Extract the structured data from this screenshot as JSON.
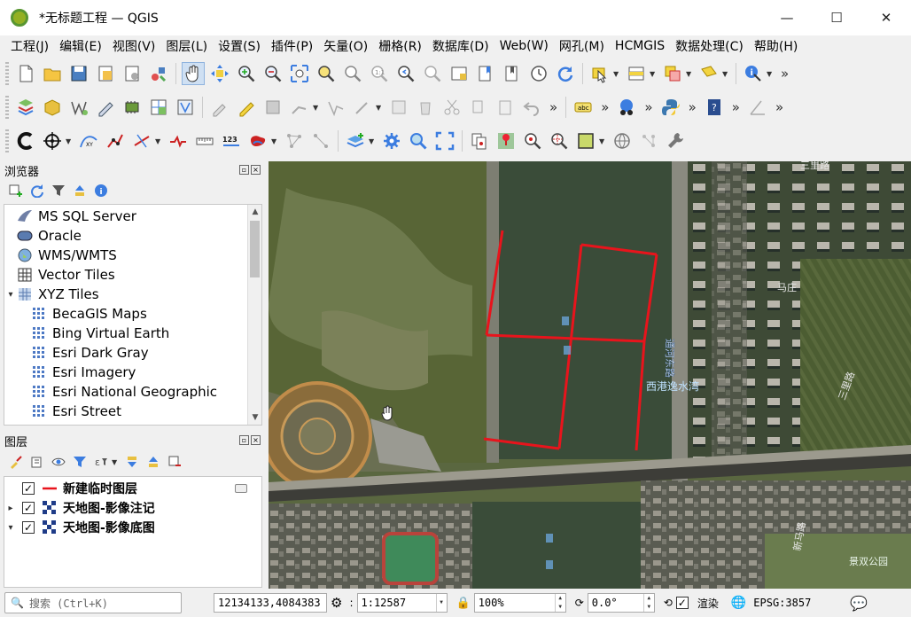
{
  "window": {
    "title": "*无标题工程 — QGIS",
    "minimize": "—",
    "maximize": "☐",
    "close": "✕"
  },
  "menu": [
    "工程(J)",
    "编辑(E)",
    "视图(V)",
    "图层(L)",
    "设置(S)",
    "插件(P)",
    "矢量(O)",
    "栅格(R)",
    "数据库(D)",
    "Web(W)",
    "网孔(M)",
    "HCMGIS",
    "数据处理(C)",
    "帮助(H)"
  ],
  "toolbar": {
    "more": "»",
    "measure_label": "123"
  },
  "browser": {
    "title": "浏览器",
    "items": [
      {
        "label": "MS SQL Server",
        "icon": "mssql-icon",
        "level": 0
      },
      {
        "label": "Oracle",
        "icon": "oracle-icon",
        "level": 0
      },
      {
        "label": "WMS/WMTS",
        "icon": "wms-globe-icon",
        "level": 0
      },
      {
        "label": "Vector Tiles",
        "icon": "vector-tiles-icon",
        "level": 0
      },
      {
        "label": "XYZ Tiles",
        "icon": "xyz-tiles-icon",
        "level": 0,
        "expanded": true
      },
      {
        "label": "BecaGIS Maps",
        "icon": "xyz-grid-icon",
        "level": 1
      },
      {
        "label": "Bing Virtual Earth",
        "icon": "xyz-grid-icon",
        "level": 1
      },
      {
        "label": "Esri Dark Gray",
        "icon": "xyz-grid-icon",
        "level": 1
      },
      {
        "label": "Esri Imagery",
        "icon": "xyz-grid-icon",
        "level": 1
      },
      {
        "label": "Esri National Geographic",
        "icon": "xyz-grid-icon",
        "level": 1
      },
      {
        "label": "Esri Street",
        "icon": "xyz-grid-icon",
        "level": 1
      }
    ]
  },
  "layers": {
    "title": "图层",
    "items": [
      {
        "label": "新建临时图层",
        "checked": true,
        "icon": "line-layer-icon",
        "expander": ""
      },
      {
        "label": "天地图-影像注记",
        "checked": true,
        "icon": "raster-layer-icon",
        "expander": "▸"
      },
      {
        "label": "天地图-影像底图",
        "checked": true,
        "icon": "raster-layer-icon",
        "expander": "▾"
      }
    ]
  },
  "map": {
    "labels": {
      "road_east": "通河东路",
      "water_name": "西港逸水湾",
      "village": "马庄",
      "park": "景双公园",
      "road_ne": "三里路",
      "road_e": "三里路",
      "road_s": "新马路"
    }
  },
  "statusbar": {
    "search_placeholder": "搜索 (Ctrl+K)",
    "coordinate": "12134133,4084383",
    "scale": "1:12587",
    "magnifier": "100%",
    "rotation": "0.0°",
    "render_label": "渲染",
    "render_checked": true,
    "crs": "EPSG:3857"
  }
}
